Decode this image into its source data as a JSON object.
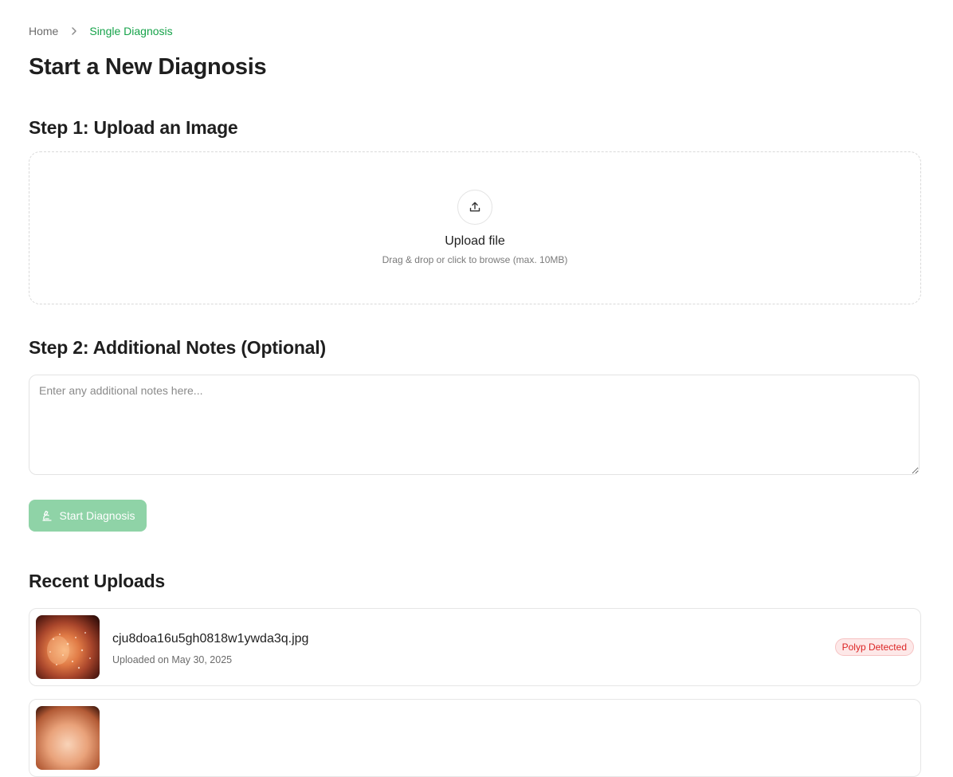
{
  "breadcrumb": {
    "home": "Home",
    "current": "Single Diagnosis"
  },
  "page_title": "Start a New Diagnosis",
  "step1": {
    "title": "Step 1: Upload an Image",
    "upload_title": "Upload file",
    "upload_hint": "Drag & drop or click to browse (max. 10MB)",
    "icon": "upload-icon"
  },
  "step2": {
    "title": "Step 2: Additional Notes (Optional)",
    "notes_value": "",
    "notes_placeholder": "Enter any additional notes here..."
  },
  "start_button": {
    "label": "Start Diagnosis",
    "icon": "microscope-icon",
    "enabled": false
  },
  "recent": {
    "title": "Recent Uploads",
    "items": [
      {
        "file_name": "cju8doa16u5gh0818w1ywda3q.jpg",
        "uploaded": "Uploaded on May 30, 2025",
        "status": "Polyp Detected"
      },
      {
        "file_name": "",
        "uploaded": "",
        "status": ""
      }
    ]
  },
  "colors": {
    "accent": "#16a34a",
    "button_disabled": "#8fd3a7",
    "danger": "#dc2626"
  }
}
